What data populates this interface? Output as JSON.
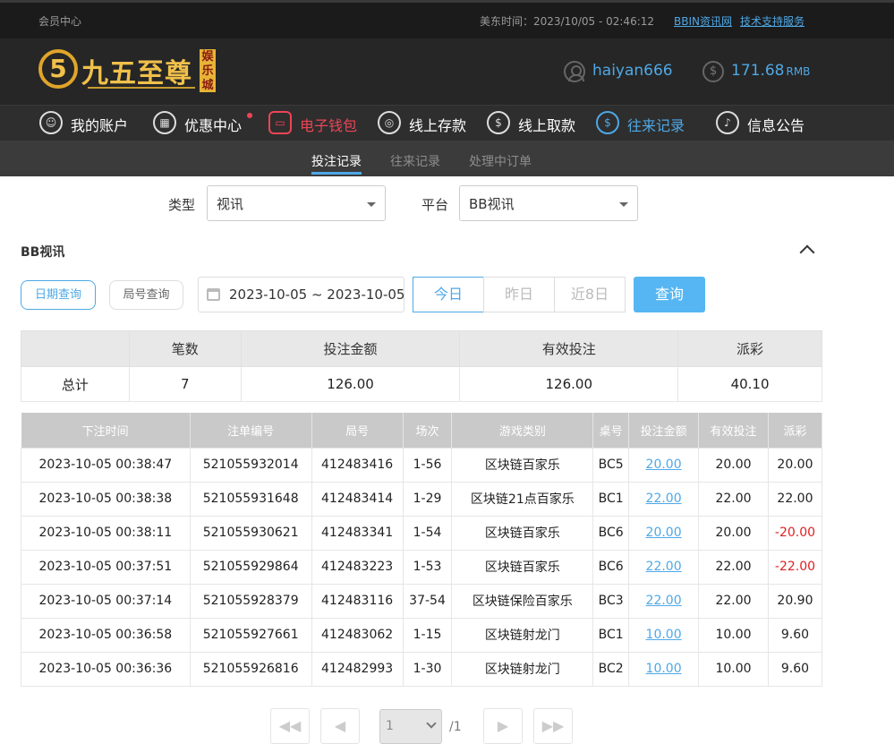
{
  "topbar": {
    "member_center": "会员中心",
    "time_label": "美东时间：2023/10/05 - 02:46:12",
    "links": [
      "BBIN资讯网",
      "技术支持服务"
    ]
  },
  "brand": {
    "logo_mark": "5",
    "name": "九五至尊",
    "stamp": "娱乐城"
  },
  "account": {
    "username": "haiyan666",
    "balance": "171.68",
    "currency": "RMB"
  },
  "nav": {
    "items": [
      {
        "label": "我的账户",
        "icon": "user-icon"
      },
      {
        "label": "优惠中心",
        "icon": "gift-icon"
      },
      {
        "label": "电子钱包",
        "icon": "wallet-icon"
      },
      {
        "label": "线上存款",
        "icon": "deposit-icon"
      },
      {
        "label": "线上取款",
        "icon": "withdraw-icon"
      },
      {
        "label": "往来记录",
        "icon": "records-icon"
      },
      {
        "label": "信息公告",
        "icon": "bell-icon"
      }
    ]
  },
  "subnav": {
    "tabs": [
      "投注记录",
      "往来记录",
      "处理中订单"
    ],
    "active": "投注记录"
  },
  "filters": {
    "type_label": "类型",
    "type_value": "视讯",
    "platform_label": "平台",
    "platform_value": "BB视讯"
  },
  "section": {
    "title": "BB视讯"
  },
  "query": {
    "date_mode_label": "日期查询",
    "round_mode_label": "局号查询",
    "date_range": "2023-10-05 ~ 2023-10-05",
    "quick": [
      "今日",
      "昨日",
      "近8日"
    ],
    "submit_label": "查询"
  },
  "summary": {
    "headers": [
      "",
      "笔数",
      "投注金额",
      "有效投注",
      "派彩"
    ],
    "row": [
      "总计",
      "7",
      "126.00",
      "126.00",
      "40.10"
    ]
  },
  "details": {
    "headers": [
      "下注时间",
      "注单编号",
      "局号",
      "场次",
      "游戏类别",
      "桌号",
      "投注金额",
      "有效投注",
      "派彩"
    ],
    "rows": [
      [
        "2023-10-05 00:38:47",
        "521055932014",
        "412483416",
        "1-56",
        "区块链百家乐",
        "BC5",
        "20.00",
        "20.00",
        "20.00"
      ],
      [
        "2023-10-05 00:38:38",
        "521055931648",
        "412483414",
        "1-29",
        "区块链21点百家乐",
        "BC1",
        "22.00",
        "22.00",
        "22.00"
      ],
      [
        "2023-10-05 00:38:11",
        "521055930621",
        "412483341",
        "1-54",
        "区块链百家乐",
        "BC6",
        "20.00",
        "20.00",
        "-20.00"
      ],
      [
        "2023-10-05 00:37:51",
        "521055929864",
        "412483223",
        "1-53",
        "区块链百家乐",
        "BC6",
        "22.00",
        "22.00",
        "-22.00"
      ],
      [
        "2023-10-05 00:37:14",
        "521055928379",
        "412483116",
        "37-54",
        "区块链保险百家乐",
        "BC3",
        "22.00",
        "22.00",
        "20.90"
      ],
      [
        "2023-10-05 00:36:58",
        "521055927661",
        "412483062",
        "1-15",
        "区块链射龙门",
        "BC1",
        "10.00",
        "10.00",
        "9.60"
      ],
      [
        "2023-10-05 00:36:36",
        "521055926816",
        "412482993",
        "1-30",
        "区块链射龙门",
        "BC2",
        "10.00",
        "10.00",
        "9.60"
      ]
    ]
  },
  "pager": {
    "current_page": "1",
    "total": "/1"
  },
  "colors": {
    "accent": "#4ea8e6",
    "negative": "#e02020",
    "wallet": "#ee4455"
  }
}
